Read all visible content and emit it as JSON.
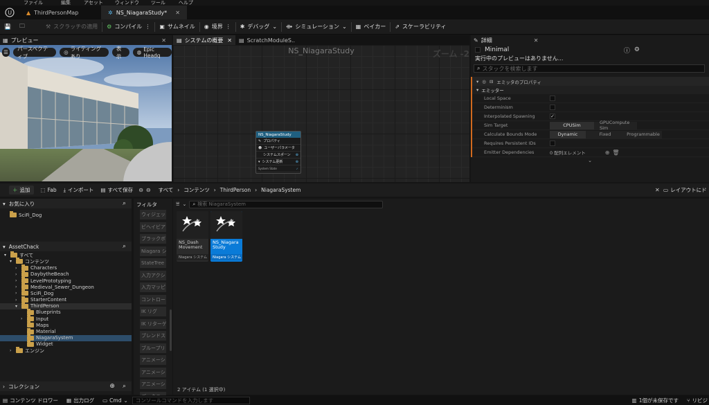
{
  "menu": [
    "ファイル",
    "編集",
    "アセット",
    "ウィンドウ",
    "ツール",
    "ヘルプ"
  ],
  "tabs": [
    {
      "label": "ThirdPersonMap",
      "active": false
    },
    {
      "label": "NS_NiagaraStudy*",
      "active": true
    }
  ],
  "toolbar": {
    "scratch_apply": "スクラッチの適用",
    "compile": "コンパイル",
    "thumbnail": "サムネイル",
    "bounds": "境界",
    "debug": "デバッグ",
    "simulation": "シミュレーション",
    "baker": "ベイカー",
    "scalability": "スケーラビリティ"
  },
  "preview": {
    "title": "プレビュー",
    "perspective": "パースペクティブ",
    "lighting": "ライティングあり",
    "show": "表示",
    "epic": "Epic Headq"
  },
  "graph": {
    "tab_overview": "システムの概要",
    "tab_scratch": "ScratchModuleS..",
    "title": "NS_NiagaraStudy",
    "zoom": "ズーム -2",
    "node": {
      "title": "NS_NiagaraStudy",
      "rows": [
        "プロパティ",
        "ユーザーパラメータ",
        "システムスポーン",
        "システム更新",
        "System State"
      ]
    }
  },
  "details": {
    "title": "詳細",
    "object": "Minimal",
    "notice": "実行中のプレビューはありません...",
    "search_placeholder": "スタックを検索します",
    "section": "エミッタのプロパティ",
    "group": "エミッター",
    "props": {
      "local_space": "Local Space",
      "determinism": "Determinism",
      "interpolated": "Interpolated Spawning",
      "sim_target": "Sim Target",
      "sim_opt1": "CPUSim",
      "sim_opt2": "GPUCompute Sim",
      "calc_bounds": "Calculate Bounds Mode",
      "bounds_opt1": "Dynamic",
      "bounds_opt2": "Fixed",
      "bounds_opt3": "Programmable",
      "persistent": "Requires Persistent IDs",
      "emitter_deps": "Emitter Dependencies",
      "deps_value": "0 配列エレメント"
    }
  },
  "content_browser": {
    "add": "追加",
    "fab": "Fab",
    "import": "インポート",
    "save_all": "すべて保存",
    "breadcrumb": [
      "すべて",
      "コンテンツ",
      "ThirdPerson",
      "NiagaraSystem"
    ],
    "layout": "レイアウトにド",
    "favorites": "お気に入り",
    "favorite_items": [
      "SciFi_Dog"
    ],
    "project": "AssetChack",
    "tree": [
      {
        "label": "すべて",
        "depth": 0
      },
      {
        "label": "コンテンツ",
        "depth": 1
      },
      {
        "label": "Characters",
        "depth": 2
      },
      {
        "label": "DaybytheBeach",
        "depth": 2
      },
      {
        "label": "LevelPrototyping",
        "depth": 2
      },
      {
        "label": "Medieval_Sewer_Dungeon",
        "depth": 2
      },
      {
        "label": "SciFi_Dog",
        "depth": 2
      },
      {
        "label": "StarterContent",
        "depth": 2
      },
      {
        "label": "ThirdPerson",
        "depth": 2
      },
      {
        "label": "Blueprints",
        "depth": 3
      },
      {
        "label": "Input",
        "depth": 3
      },
      {
        "label": "Maps",
        "depth": 3
      },
      {
        "label": "Material",
        "depth": 3
      },
      {
        "label": "NiagaraSystem",
        "depth": 3
      },
      {
        "label": "Widget",
        "depth": 3
      },
      {
        "label": "エンジン",
        "depth": 1
      }
    ],
    "collection": "コレクション",
    "filters_title": "フィルタ",
    "filters": [
      "ウィジェット",
      "ビヘイビア",
      "ブラックボ",
      "Niagara シ",
      "StateTree",
      "入力アクシ",
      "入力マッピ",
      "コントロー",
      "IK リグ",
      "IK リターゲ",
      "ブレンドス",
      "ブループリ",
      "アニメーシ",
      "アニメーシ",
      "アニメーシ",
      "データテー"
    ],
    "search_placeholder": "検索 NiagaraSystem",
    "assets": [
      {
        "name": "NS_Dash Movement",
        "type": "Niagara システム",
        "selected": false
      },
      {
        "name": "NS_Niagara Study",
        "type": "Niagara システム",
        "selected": true
      }
    ],
    "count": "2 アイテム (1 選択中)"
  },
  "status": {
    "content_drawer": "コンテンツ ドロワー",
    "output_log": "出力ログ",
    "cmd": "Cmd",
    "console_placeholder": "コンソールコマンドを入力します",
    "unsaved": "1個が未保存です",
    "revision": "リビジ"
  }
}
